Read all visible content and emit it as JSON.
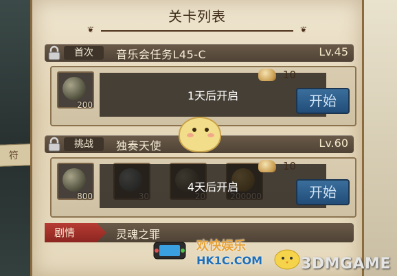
{
  "panel": {
    "title": "关卡列表"
  },
  "background": {
    "left_ribbon_text": "符"
  },
  "stages": [
    {
      "tag": "首次",
      "name": "音乐会任务L45-C",
      "level": "Lv.45",
      "overlay_text": "1天后开启",
      "cost": "10",
      "start_label": "开始",
      "items": [
        {
          "icon": "relic-orb-icon",
          "qty": "200"
        }
      ]
    },
    {
      "tag": "挑战",
      "name": "独奏天使",
      "level": "Lv.60",
      "overlay_text": "4天后开启",
      "cost": "10",
      "start_label": "开始",
      "items": [
        {
          "icon": "relic-orb-icon",
          "qty": "800"
        },
        {
          "icon": "blue-orb-icon",
          "qty": "30"
        },
        {
          "icon": "relic-orb-icon",
          "qty": "20"
        },
        {
          "icon": "gold-coin-icon",
          "qty": "200000"
        }
      ]
    }
  ],
  "story": {
    "tag": "剧情",
    "name": "灵魂之罪"
  },
  "watermark": {
    "site_text": "欢快娱乐",
    "url": "HK1C.COM",
    "brand": "3DMGAME"
  },
  "colors": {
    "start_button": "#2a5a88",
    "story_tag": "#a5302a",
    "header_bar": "#5b4d3f"
  }
}
